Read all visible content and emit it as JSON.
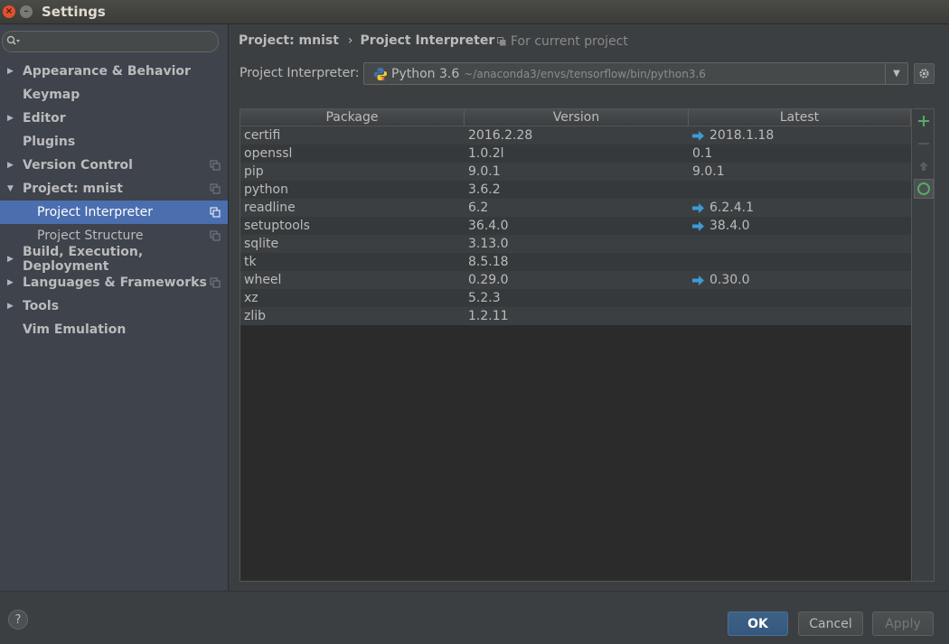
{
  "window": {
    "title": "Settings"
  },
  "sidebar": {
    "search_placeholder": "",
    "items": [
      {
        "label": "Appearance & Behavior",
        "arrow": "right",
        "level": 0,
        "copy": false
      },
      {
        "label": "Keymap",
        "arrow": "",
        "level": 0,
        "copy": false
      },
      {
        "label": "Editor",
        "arrow": "right",
        "level": 0,
        "copy": false
      },
      {
        "label": "Plugins",
        "arrow": "",
        "level": 0,
        "copy": false
      },
      {
        "label": "Version Control",
        "arrow": "right",
        "level": 0,
        "copy": true
      },
      {
        "label": "Project: mnist",
        "arrow": "down",
        "level": 0,
        "copy": true
      },
      {
        "label": "Project Interpreter",
        "arrow": "",
        "level": 1,
        "copy": true,
        "selected": true
      },
      {
        "label": "Project Structure",
        "arrow": "",
        "level": 1,
        "copy": true
      },
      {
        "label": "Build, Execution, Deployment",
        "arrow": "right",
        "level": 0,
        "copy": false
      },
      {
        "label": "Languages & Frameworks",
        "arrow": "right",
        "level": 0,
        "copy": true
      },
      {
        "label": "Tools",
        "arrow": "right",
        "level": 0,
        "copy": false
      },
      {
        "label": "Vim Emulation",
        "arrow": "",
        "level": 0,
        "copy": false
      }
    ]
  },
  "header": {
    "breadcrumb": [
      "Project: mnist",
      "Project Interpreter"
    ],
    "separator": "›",
    "for_current_project": "For current project"
  },
  "interpreter": {
    "label": "Project Interpreter:",
    "name": "Python 3.6",
    "path": "~/anaconda3/envs/tensorflow/bin/python3.6"
  },
  "table": {
    "columns": [
      "Package",
      "Version",
      "Latest"
    ],
    "rows": [
      {
        "package": "certifi",
        "version": "2016.2.28",
        "latest": "2018.1.18",
        "upgrade": true
      },
      {
        "package": "openssl",
        "version": "1.0.2l",
        "latest": "0.1",
        "upgrade": false
      },
      {
        "package": "pip",
        "version": "9.0.1",
        "latest": "9.0.1",
        "upgrade": false
      },
      {
        "package": "python",
        "version": "3.6.2",
        "latest": "",
        "upgrade": false
      },
      {
        "package": "readline",
        "version": "6.2",
        "latest": "6.2.4.1",
        "upgrade": true
      },
      {
        "package": "setuptools",
        "version": "36.4.0",
        "latest": "38.4.0",
        "upgrade": true
      },
      {
        "package": "sqlite",
        "version": "3.13.0",
        "latest": "",
        "upgrade": false
      },
      {
        "package": "tk",
        "version": "8.5.18",
        "latest": "",
        "upgrade": false
      },
      {
        "package": "wheel",
        "version": "0.29.0",
        "latest": "0.30.0",
        "upgrade": true
      },
      {
        "package": "xz",
        "version": "5.2.3",
        "latest": "",
        "upgrade": false
      },
      {
        "package": "zlib",
        "version": "1.2.11",
        "latest": "",
        "upgrade": false
      }
    ]
  },
  "toolbar": {
    "add_icon": "plus-icon",
    "remove_icon": "minus-icon",
    "upgrade_icon": "up-arrow-icon",
    "refresh_icon": "circle-icon"
  },
  "buttons": {
    "help": "?",
    "ok": "OK",
    "cancel": "Cancel",
    "apply": "Apply"
  },
  "colors": {
    "accent": "#4b6eaf",
    "upgrade_arrow": "#3d9ad6",
    "add_green": "#59a869"
  }
}
